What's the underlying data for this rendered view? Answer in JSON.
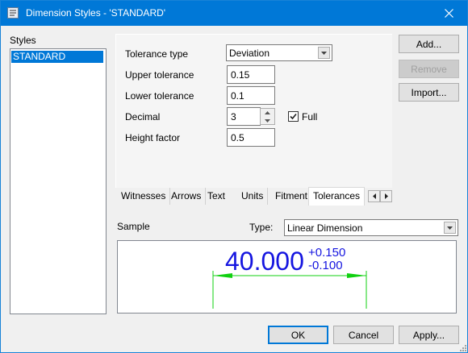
{
  "window": {
    "title": "Dimension Styles - 'STANDARD'"
  },
  "styles": {
    "label": "Styles",
    "items": [
      "STANDARD"
    ]
  },
  "form": {
    "tolerance_type_label": "Tolerance type",
    "tolerance_type_value": "Deviation",
    "upper_label": "Upper tolerance",
    "upper_value": "0.15",
    "lower_label": "Lower tolerance",
    "lower_value": "0.1",
    "decimal_label": "Decimal",
    "decimal_value": "3",
    "full_label": "Full",
    "full_checked": true,
    "height_label": "Height factor",
    "height_value": "0.5"
  },
  "side_buttons": {
    "add": "Add...",
    "remove": "Remove",
    "import": "Import..."
  },
  "tabs": [
    "Witnesses",
    "Arrows",
    "Text",
    "Units",
    "Fitment",
    "Tolerances"
  ],
  "active_tab": "Tolerances",
  "sample": {
    "label": "Sample",
    "type_label": "Type:",
    "type_value": "Linear Dimension",
    "dimension_value": "40.000",
    "upper_tol": "+0.150",
    "lower_tol": "-0.100",
    "text_color": "#1515e0",
    "line_color": "#10d010"
  },
  "bottom_buttons": {
    "ok": "OK",
    "cancel": "Cancel",
    "apply": "Apply..."
  }
}
